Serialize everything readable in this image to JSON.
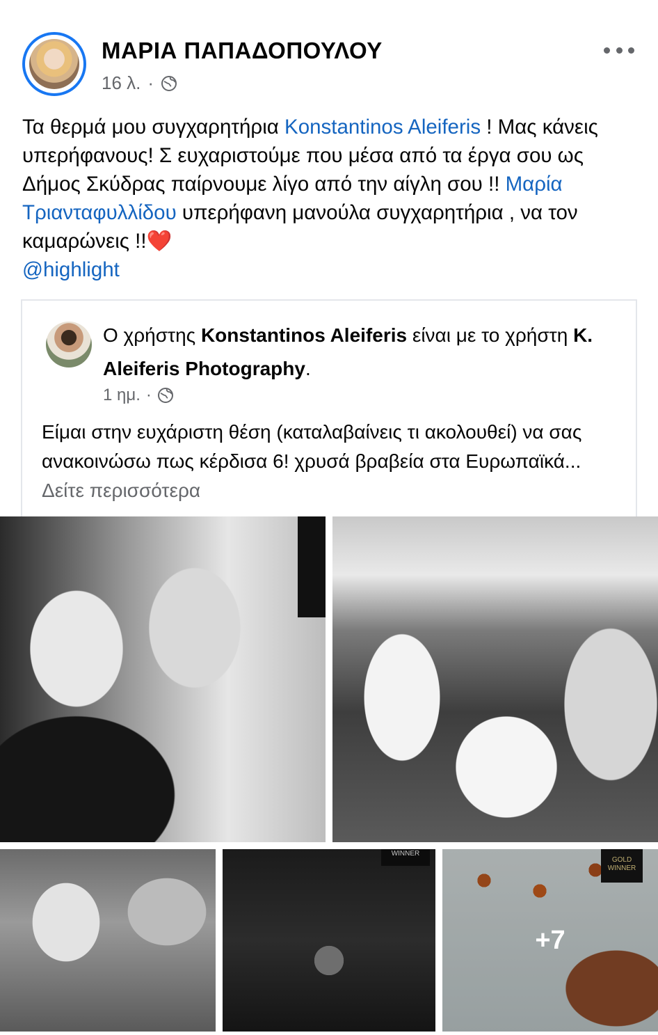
{
  "post": {
    "author": "ΜΑΡΙΑ ΠΑΠΑΔΟΠΟΥΛΟΥ",
    "time": "16 λ.",
    "separator": "·",
    "privacy_icon": "globe-icon",
    "text_1": "Τα θερμά μου συγχαρητήρια ",
    "mention_1": "Konstantinos Aleiferis",
    "text_2": " ! Μας κάνεις υπερήφανους! Σ ευχαριστούμε που μέσα από τα έργα σου ως Δήμος Σκύδρας παίρνουμε λίγο από την αίγλη σου !! ",
    "mention_2": "Μαρία Τριανταφυλλίδου",
    "text_3": " υπερήφανη μανούλα συγχαρητήρια , να τον καμαρώνεις !!",
    "heart": "❤️",
    "mention_3": "@highlight"
  },
  "shared": {
    "prefix": "Ο χρήστης ",
    "author": "Konstantinos Aleiferis",
    "middle": " είναι με το χρήστη ",
    "tagged": "K. Aleiferis Photography",
    "suffix": ".",
    "time": "1 ημ.",
    "separator": "·",
    "body": "Είμαι στην ευχάριστη θέση (καταλαβαίνεις τι ακολουθεί) να σας ανακοινώσω πως κέρδισα 6! χρυσά βραβεία στα Ευρωπαϊκά...",
    "see_more": " Δείτε περισσότερα"
  },
  "gallery": {
    "badge_winner": "WINNER",
    "badge_gold": "GOLD WINNER",
    "more_count": "+7"
  },
  "colors": {
    "link": "#1565c0",
    "meta": "#65676b",
    "ring": "#1877f2"
  }
}
